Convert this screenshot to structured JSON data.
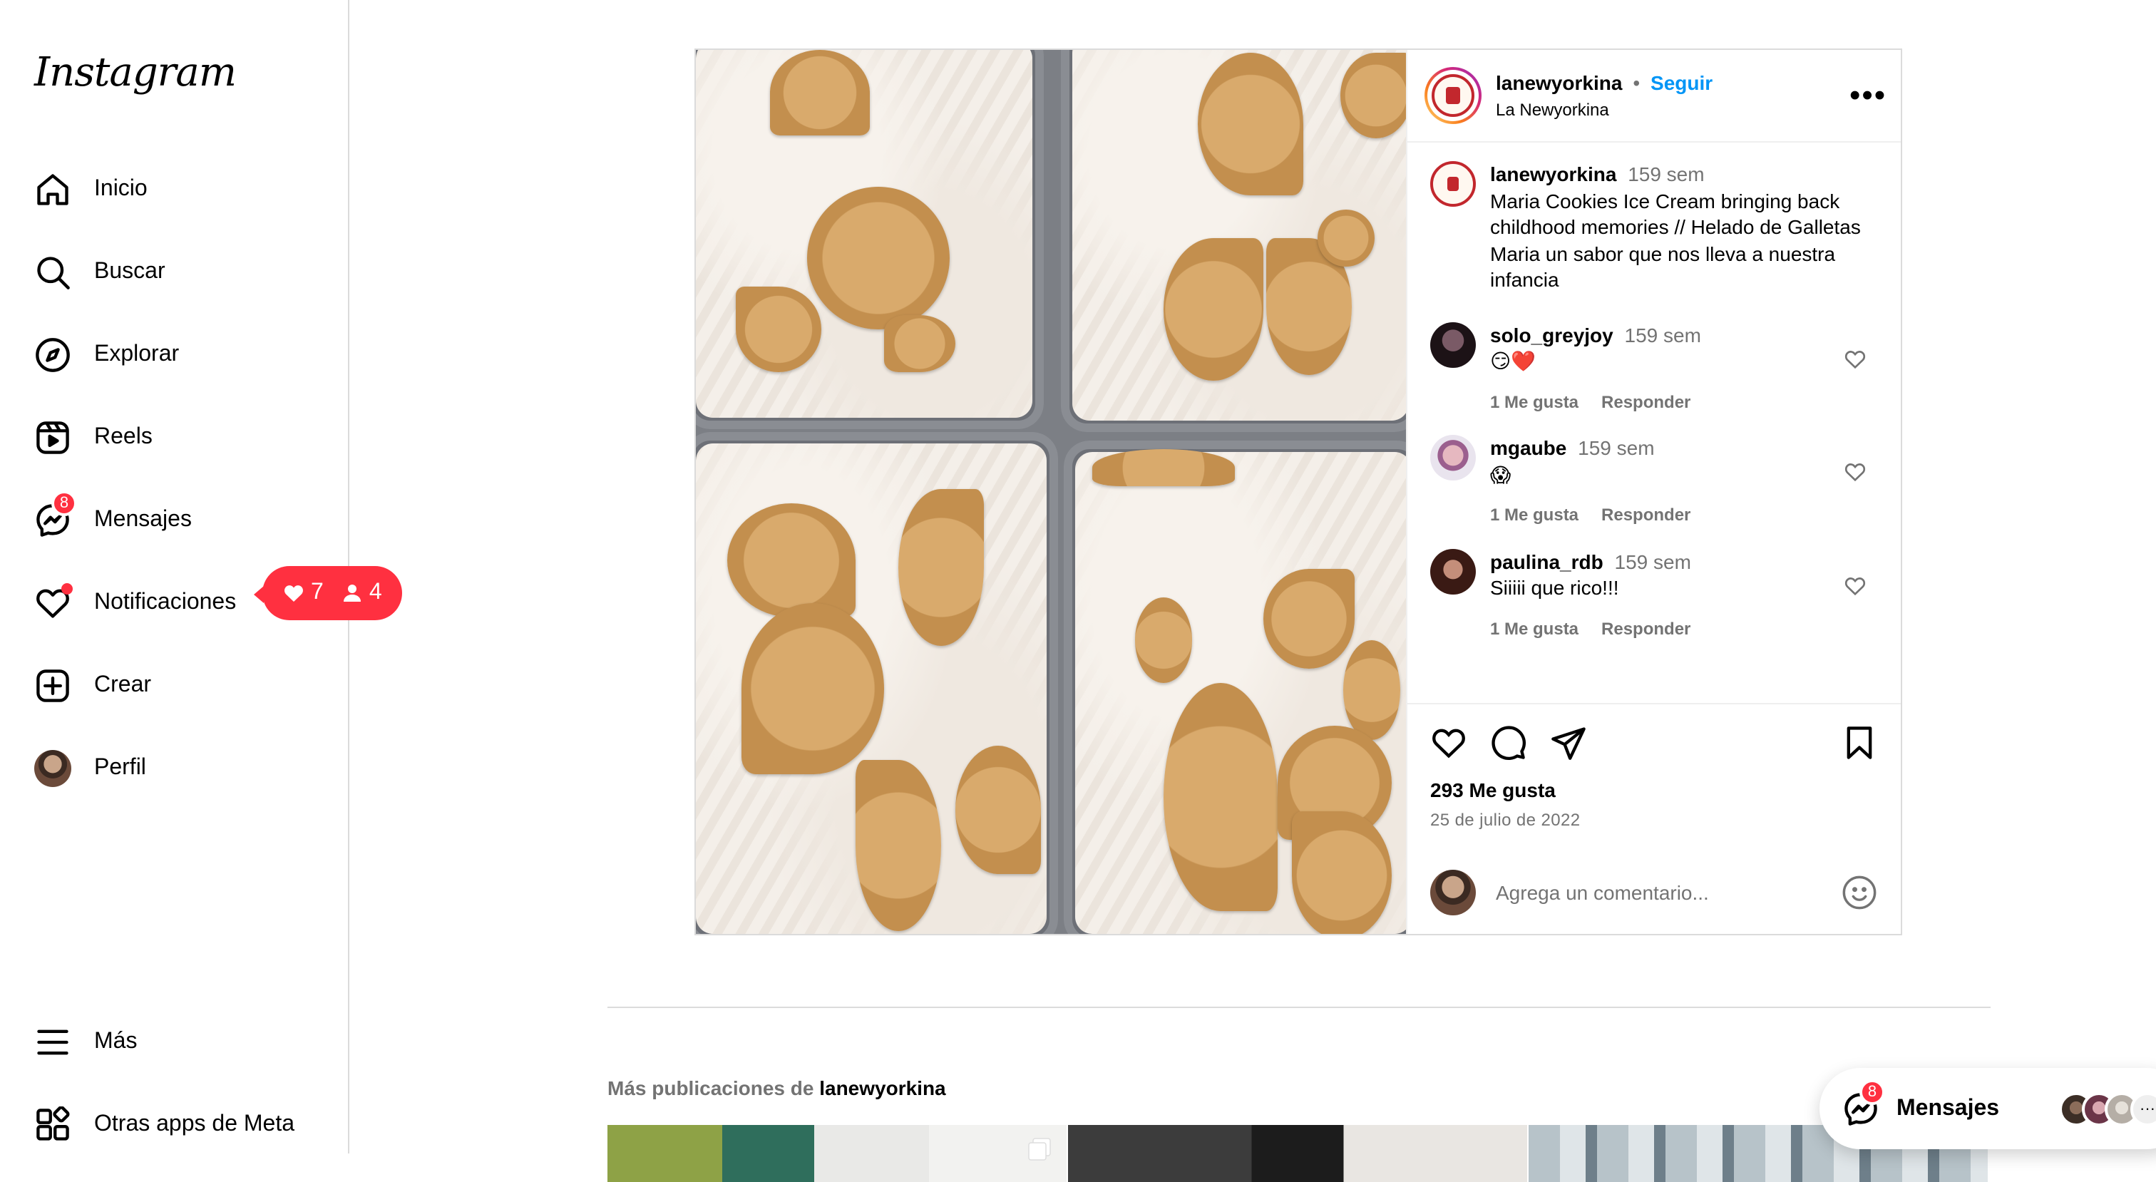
{
  "brand": {
    "name": "Instagram"
  },
  "nav": {
    "items": [
      {
        "label": "Inicio"
      },
      {
        "label": "Buscar"
      },
      {
        "label": "Explorar"
      },
      {
        "label": "Reels"
      },
      {
        "label": "Mensajes",
        "badge": "8"
      },
      {
        "label": "Notificaciones"
      },
      {
        "label": "Crear"
      },
      {
        "label": "Perfil"
      }
    ],
    "bottom": [
      {
        "label": "Más"
      },
      {
        "label": "Otras apps de Meta"
      }
    ],
    "notif_pill": {
      "likes": "7",
      "follows": "4"
    }
  },
  "post": {
    "header": {
      "username": "lanewyorkina",
      "separator": "•",
      "follow_label": "Seguir",
      "display_name": "La Newyorkina",
      "more_label": "•••"
    },
    "caption": {
      "username": "lanewyorkina",
      "time": "159 sem",
      "text": "Maria Cookies Ice Cream bringing back childhood memories // Helado de Galletas Maria un sabor que nos lleva a nuestra infancia"
    },
    "comments": [
      {
        "username": "solo_greyjoy",
        "time": "159 sem",
        "text": "😏❤️",
        "likes": "1 Me gusta",
        "reply": "Responder"
      },
      {
        "username": "mgaube",
        "time": "159 sem",
        "text": "😱",
        "likes": "1 Me gusta",
        "reply": "Responder"
      },
      {
        "username": "paulina_rdb",
        "time": "159 sem",
        "text": "Siiiii que rico!!!",
        "likes": "1 Me gusta",
        "reply": "Responder"
      }
    ],
    "likes": "293 Me gusta",
    "date": "25 de julio de 2022",
    "comment_placeholder": "Agrega un comentario..."
  },
  "more_posts": {
    "prefix": "Más publicaciones de",
    "username": "lanewyorkina"
  },
  "messages_float": {
    "label": "Mensajes",
    "badge": "8",
    "overflow": "···"
  },
  "colors": {
    "accent": "#0095f6",
    "badge": "#ff3040",
    "border": "#dbdbdb",
    "muted": "#737373"
  }
}
